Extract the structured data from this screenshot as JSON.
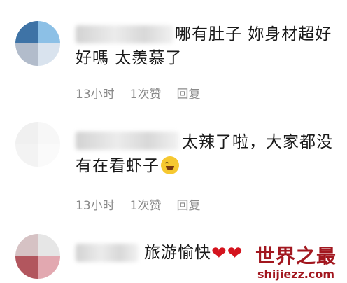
{
  "comments": [
    {
      "text": "哪有肚子 妳身材超好好嗎 太羨慕了",
      "time": "13小时",
      "likes": "1次赞",
      "reply": "回复",
      "avatar_colors": [
        "#3e73a6",
        "#8cc0e6",
        "#b2bccb",
        "#d9e3ee"
      ]
    },
    {
      "text": "太辣了啦，大家都没有在看虾子",
      "emoji": "laughing-crying-emoji",
      "time": "13小时",
      "likes": "1次赞",
      "reply": "回复",
      "avatar_colors": [
        "#f0f0f0",
        "#f7f7f7",
        "#f3f3f3",
        "#fafafa"
      ]
    },
    {
      "text": "旅游愉快",
      "hearts": "❤❤",
      "avatar_colors": [
        "#d6c2c4",
        "#e6e6e6",
        "#b2565e",
        "#e2a8b0"
      ]
    }
  ],
  "watermark": {
    "main": "世界之最",
    "sub": "shijiezz.com"
  }
}
